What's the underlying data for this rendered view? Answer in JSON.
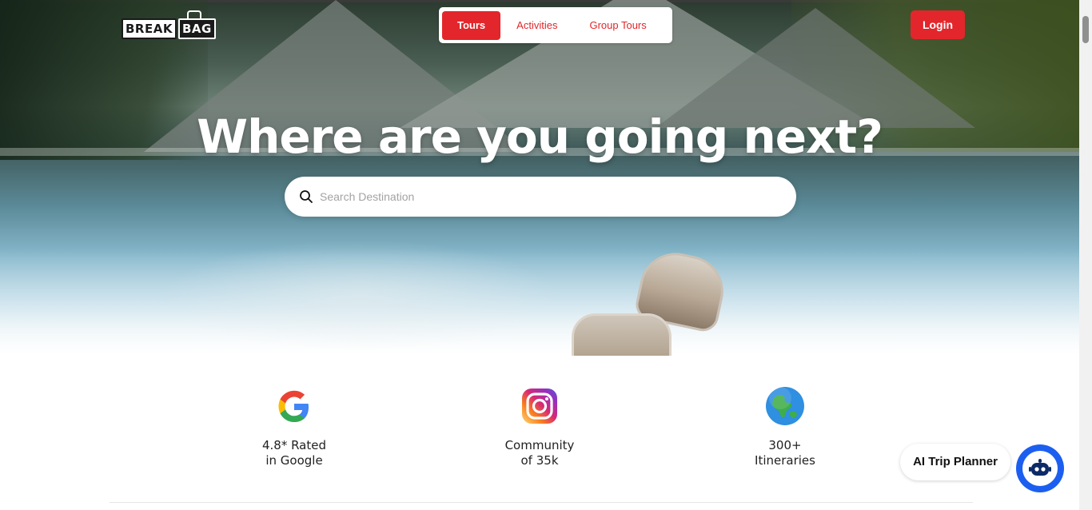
{
  "brand": {
    "logo_part1": "BREAK",
    "logo_part2": "BAG"
  },
  "nav": {
    "tabs": [
      {
        "label": "Tours",
        "active": true
      },
      {
        "label": "Activities",
        "active": false
      },
      {
        "label": "Group Tours",
        "active": false
      }
    ],
    "login_label": "Login"
  },
  "hero": {
    "title": "Where are you going next?",
    "search_placeholder": "Search Destination"
  },
  "stats": [
    {
      "icon": "google-icon",
      "line1": "4.8* Rated",
      "line2": "in Google"
    },
    {
      "icon": "instagram-icon",
      "line1": "Community",
      "line2": "of 35k"
    },
    {
      "icon": "globe-icon",
      "line1": "300+",
      "line2": "Itineraries"
    }
  ],
  "ai_planner": {
    "label": "AI Trip Planner",
    "icon": "robot-icon"
  },
  "colors": {
    "accent": "#e3262b",
    "ai_blue": "#1c5ff0"
  }
}
